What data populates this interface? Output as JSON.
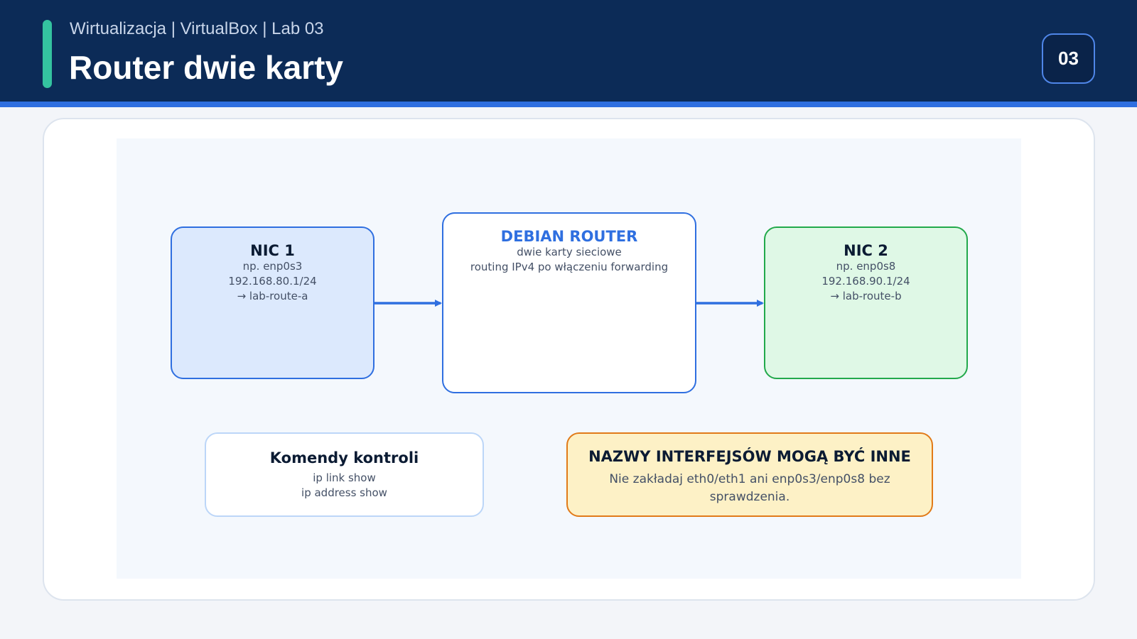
{
  "header": {
    "subtitle": "Wirtualizacja | VirtualBox | Lab 03",
    "title": "Router dwie karty",
    "slide_number": "03"
  },
  "diagram": {
    "nic1": {
      "title": "NIC 1",
      "lines": [
        "np. enp0s3",
        "192.168.80.1/24",
        "→ lab-route-a"
      ]
    },
    "router": {
      "title": "DEBIAN ROUTER",
      "lines": [
        "dwie karty sieciowe",
        "routing IPv4 po włączeniu forwarding"
      ]
    },
    "nic2": {
      "title": "NIC 2",
      "lines": [
        "np. enp0s8",
        "192.168.90.1/24",
        "→ lab-route-b"
      ]
    },
    "commands": {
      "title": "Komendy kontroli",
      "lines": [
        "ip link show",
        "ip address show"
      ]
    },
    "warning": {
      "title": "NAZWY INTERFEJSÓW MOGĄ BYĆ INNE",
      "text": "Nie zakładaj eth0/eth1 ani enp0s3/enp0s8 bez sprawdzenia."
    }
  },
  "colors": {
    "header_bg": "#0c2b57",
    "accent": "#34c3a0",
    "blue": "#2f6fe0",
    "green": "#22a94b",
    "orange": "#e17a18"
  }
}
